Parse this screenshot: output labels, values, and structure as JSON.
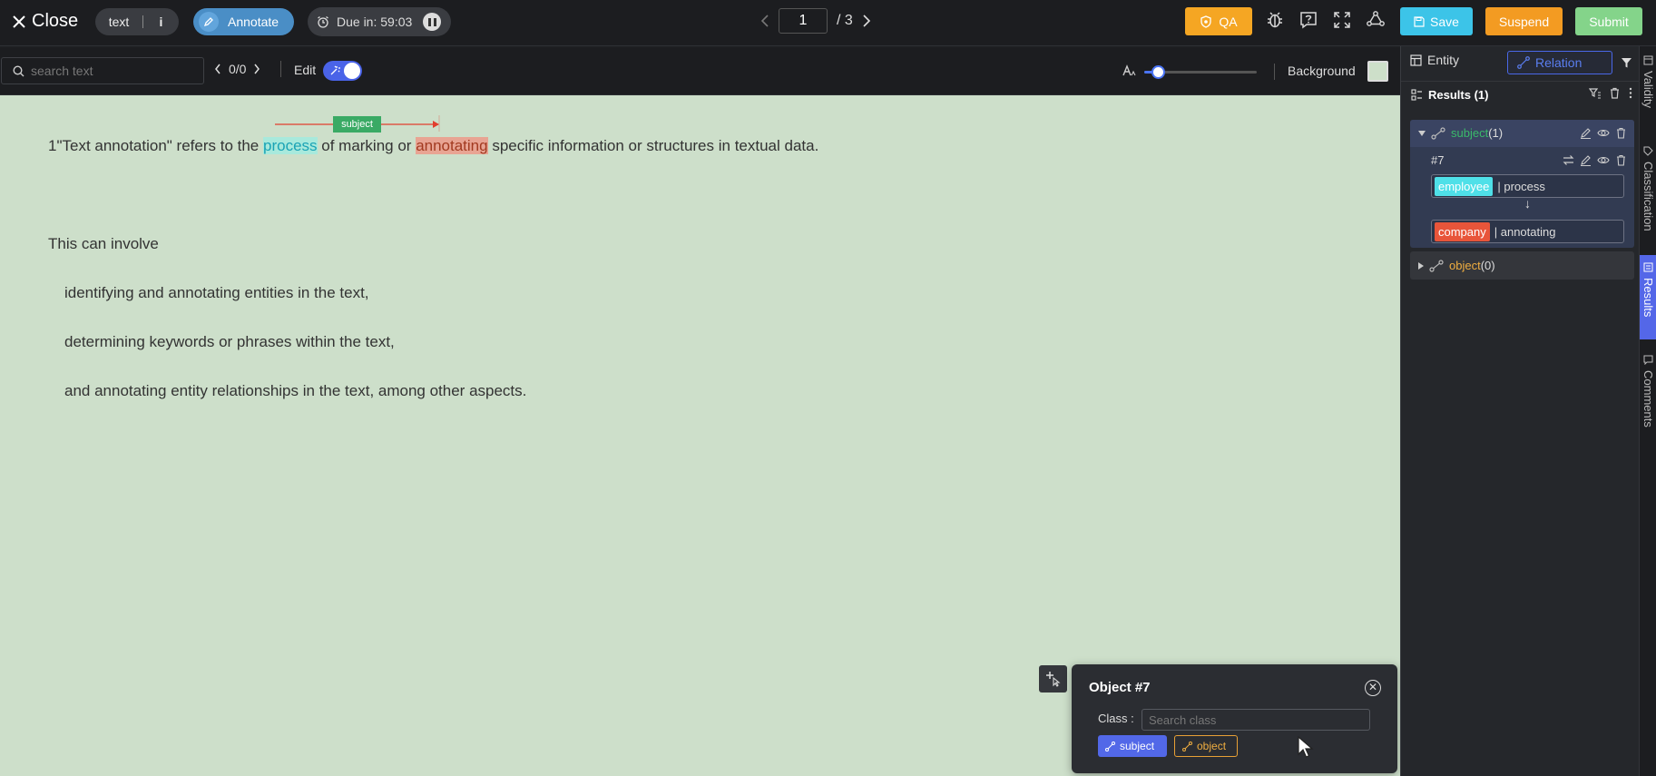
{
  "topbar": {
    "close_label": "Close",
    "mode_pill": "text",
    "info_label": "i",
    "annotate_label": "Annotate",
    "due_label": "Due in: 59:03",
    "page_current": "1",
    "page_total": "/ 3",
    "qa_label": "QA",
    "save_label": "Save",
    "suspend_label": "Suspend",
    "submit_label": "Submit"
  },
  "toolbar": {
    "search_placeholder": "search text",
    "match_count": "0/0",
    "edit_label": "Edit",
    "edit_enabled": true,
    "font_size_fraction": 0.12,
    "background_label": "Background"
  },
  "document": {
    "line1": {
      "before": "1\"Text annotation\" refers to the ",
      "entity1": "process",
      "middle": " of marking or ",
      "entity2": "annotating",
      "after": " specific information or structures in textual data."
    },
    "relation_label": "subject",
    "line2": "This can involve",
    "line3": "identifying and annotating entities in the text,",
    "line4": "determining keywords or phrases within the text,",
    "line5": "and annotating entity relationships in the text, among other aspects."
  },
  "popup": {
    "title": "Object #7",
    "class_label": "Class",
    "class_colon": ":",
    "class_placeholder": "Search class",
    "tag_subject": "subject",
    "tag_object": "object"
  },
  "panel": {
    "tab_entity": "Entity",
    "tab_relation": "Relation",
    "results_label": "Results (1)",
    "subject_group": {
      "name": "subject",
      "count": "(1)"
    },
    "relation": {
      "id": "#7",
      "from_class": "employee",
      "from_text": "| process",
      "to_class": "company",
      "to_text": "| annotating",
      "arrow": "↓"
    },
    "object_group": {
      "name": "object",
      "count": "(0)"
    }
  },
  "side_tabs": [
    "Validity",
    "Classification",
    "Results",
    "Comments"
  ],
  "colors": {
    "canvas_bg": "#cddfca",
    "accent_blue": "#4a68e8",
    "subject_green": "#3aaa65",
    "object_orange": "#f0ae40",
    "employee_tag": "#4fe0e8",
    "company_tag": "#e8553a",
    "qa": "#f5a623",
    "save": "#3cc4e8",
    "suspend": "#f39b22",
    "submit": "#84d48a"
  },
  "icons": [
    "close-icon",
    "info-icon",
    "pencil-icon",
    "alarm-icon",
    "pause-icon",
    "chevron-left-icon",
    "chevron-right-icon",
    "shield-icon",
    "bug-icon",
    "help-icon",
    "fullscreen-icon",
    "graph-icon",
    "save-icon",
    "search-icon",
    "magic-icon",
    "font-size-icon",
    "table-icon",
    "relation-icon",
    "filter-icon",
    "list-icon",
    "trash-icon",
    "more-icon",
    "edit-icon",
    "eye-icon",
    "swap-icon",
    "close-circle-icon",
    "cursor-icon"
  ]
}
